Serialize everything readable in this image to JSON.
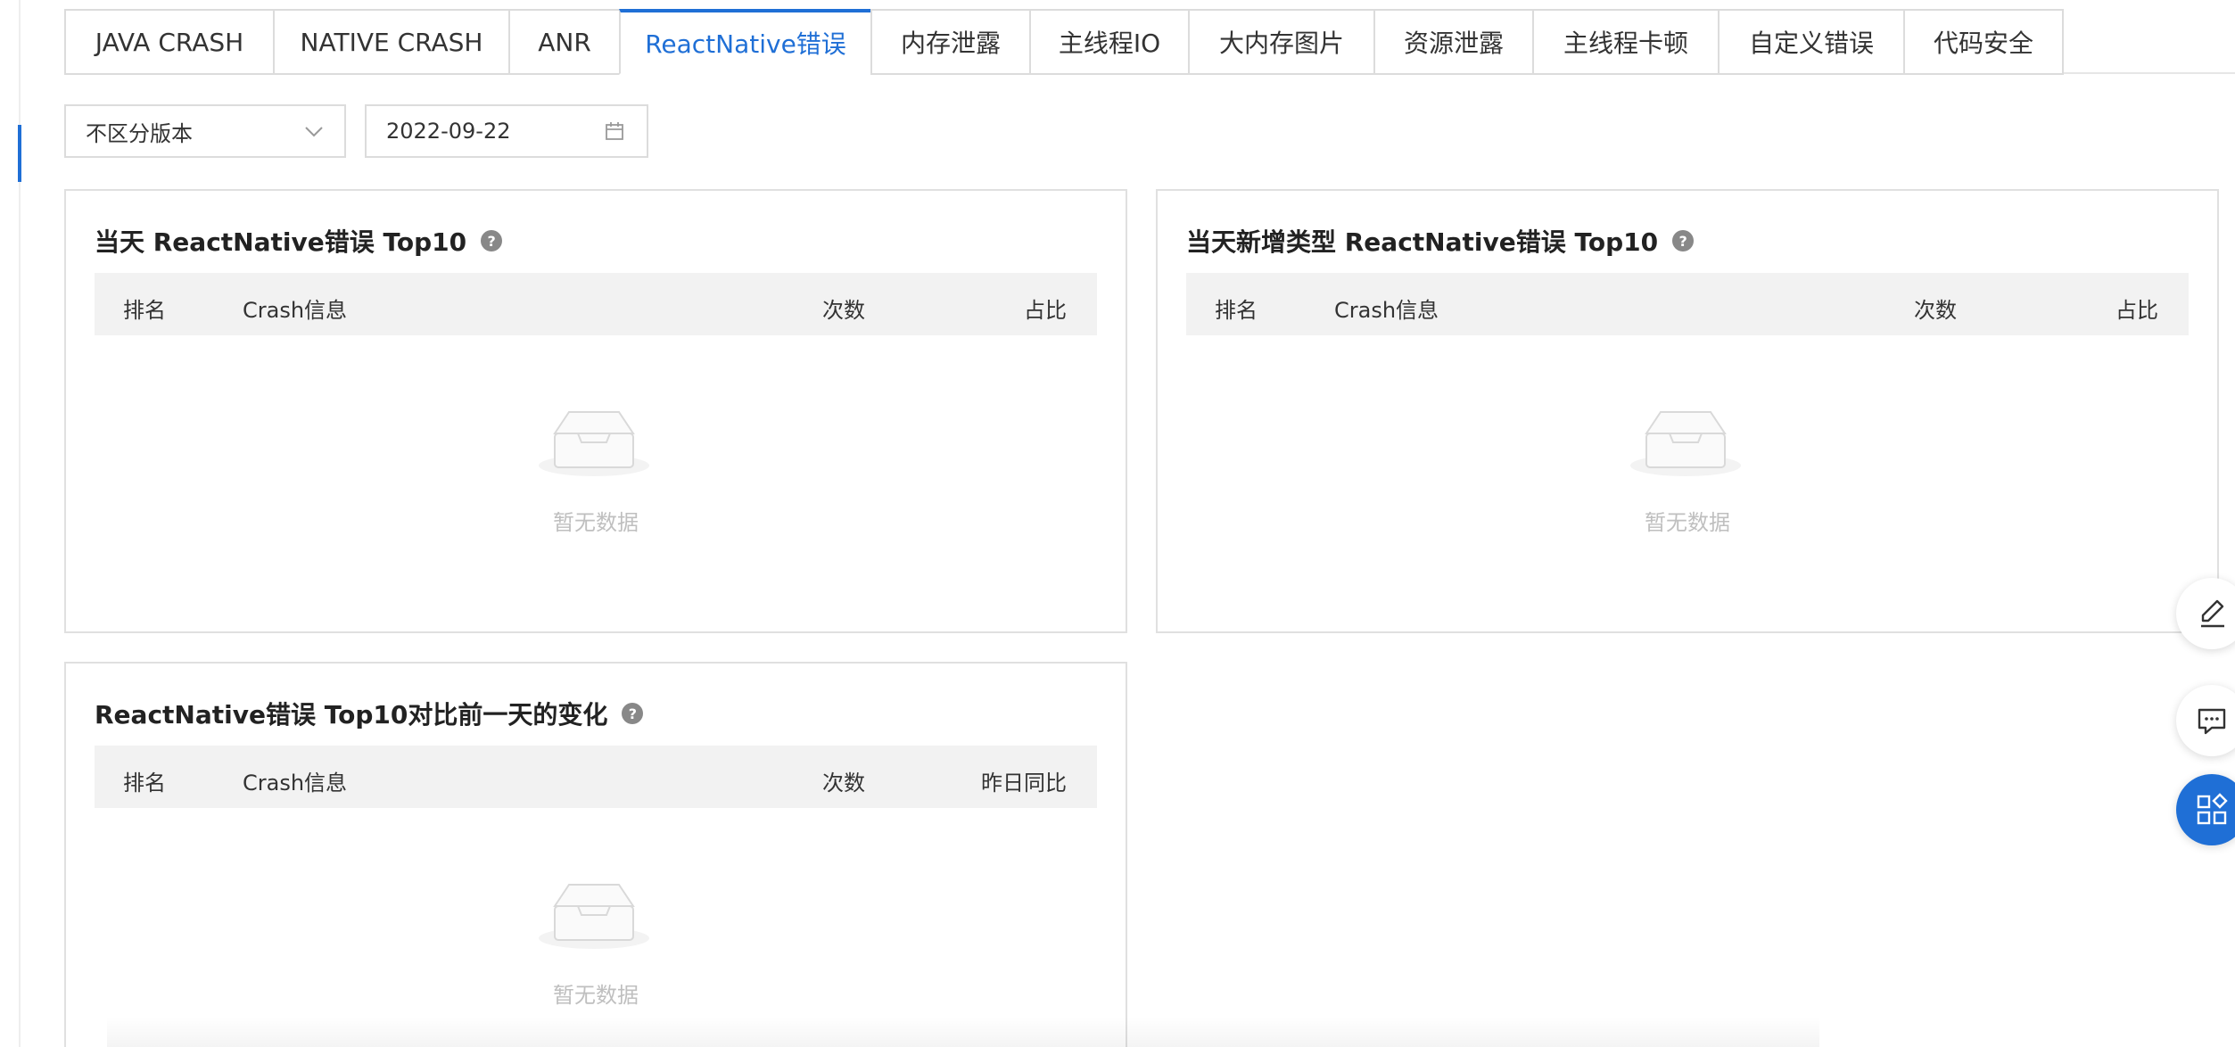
{
  "tabs": [
    {
      "label": "JAVA CRASH",
      "active": false
    },
    {
      "label": "NATIVE CRASH",
      "active": false
    },
    {
      "label": "ANR",
      "active": false
    },
    {
      "label": "ReactNative错误",
      "active": true
    },
    {
      "label": "内存泄露",
      "active": false
    },
    {
      "label": "主线程IO",
      "active": false
    },
    {
      "label": "大内存图片",
      "active": false
    },
    {
      "label": "资源泄露",
      "active": false
    },
    {
      "label": "主线程卡顿",
      "active": false
    },
    {
      "label": "自定义错误",
      "active": false
    },
    {
      "label": "代码安全",
      "active": false
    }
  ],
  "filters": {
    "version_select": "不区分版本",
    "date": "2022-09-22"
  },
  "panels": {
    "today_top10": {
      "title": "当天 ReactNative错误 Top10",
      "columns": [
        "排名",
        "Crash信息",
        "次数",
        "占比"
      ],
      "empty_text": "暂无数据"
    },
    "new_type_top10": {
      "title": "当天新增类型 ReactNative错误 Top10",
      "columns": [
        "排名",
        "Crash信息",
        "次数",
        "占比"
      ],
      "empty_text": "暂无数据"
    },
    "compare_top10": {
      "title": "ReactNative错误 Top10对比前一天的变化",
      "columns": [
        "排名",
        "Crash信息",
        "次数",
        "昨日同比"
      ],
      "empty_text": "暂无数据"
    }
  },
  "icons": {
    "help": "question-circle-icon",
    "edit": "edit-icon",
    "feedback": "message-icon",
    "apps": "apps-icon"
  },
  "colors": {
    "accent": "#1f6fd6",
    "header_bg": "#f2f2f2",
    "border": "#e0e0e0",
    "empty_text": "#bfbfbf"
  }
}
